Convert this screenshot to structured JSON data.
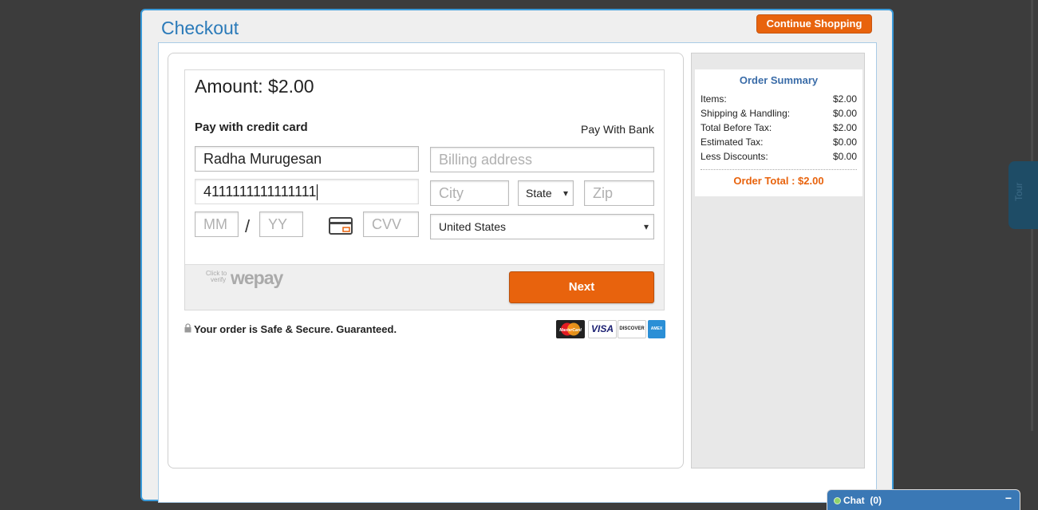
{
  "modal": {
    "title": "Checkout",
    "continue_label": "Continue Shopping"
  },
  "payment": {
    "amount_label": "Amount: $2.00",
    "pay_credit_label": "Pay with credit card",
    "pay_bank_label": "Pay With Bank",
    "name_value": "Radha Murugesan",
    "card_number_value": "4111111111111111",
    "mm_placeholder": "MM",
    "yy_placeholder": "YY",
    "date_separator": "/",
    "cvv_placeholder": "CVV",
    "billing_placeholder": "Billing address",
    "city_placeholder": "City",
    "state_value": "State",
    "zip_placeholder": "Zip",
    "country_value": "United States",
    "wepay_verify_line1": "Click to",
    "wepay_verify_line2": "verify",
    "wepay_logo": "wepay",
    "next_label": "Next",
    "secure_text": "Your order is Safe & Secure. Guaranteed.",
    "card_logos": [
      "MasterCard",
      "VISA",
      "DISCOVER",
      "AMEX"
    ]
  },
  "summary": {
    "title": "Order Summary",
    "rows": [
      {
        "label": "Items:",
        "value": "$2.00"
      },
      {
        "label": "Shipping & Handling:",
        "value": "$0.00"
      },
      {
        "label": "Total Before Tax:",
        "value": "$2.00"
      },
      {
        "label": "Estimated Tax:",
        "value": "$0.00"
      },
      {
        "label": "Less Discounts:",
        "value": "$0.00"
      }
    ],
    "total": "Order Total : $2.00"
  },
  "side_tab": {
    "label": "Tour"
  },
  "chat": {
    "label": "Chat",
    "count": "(0)",
    "minimize": "−"
  },
  "colors": {
    "accent": "#e8630d",
    "title_blue": "#2a7ab9",
    "chat_blue": "#3a78b5"
  }
}
